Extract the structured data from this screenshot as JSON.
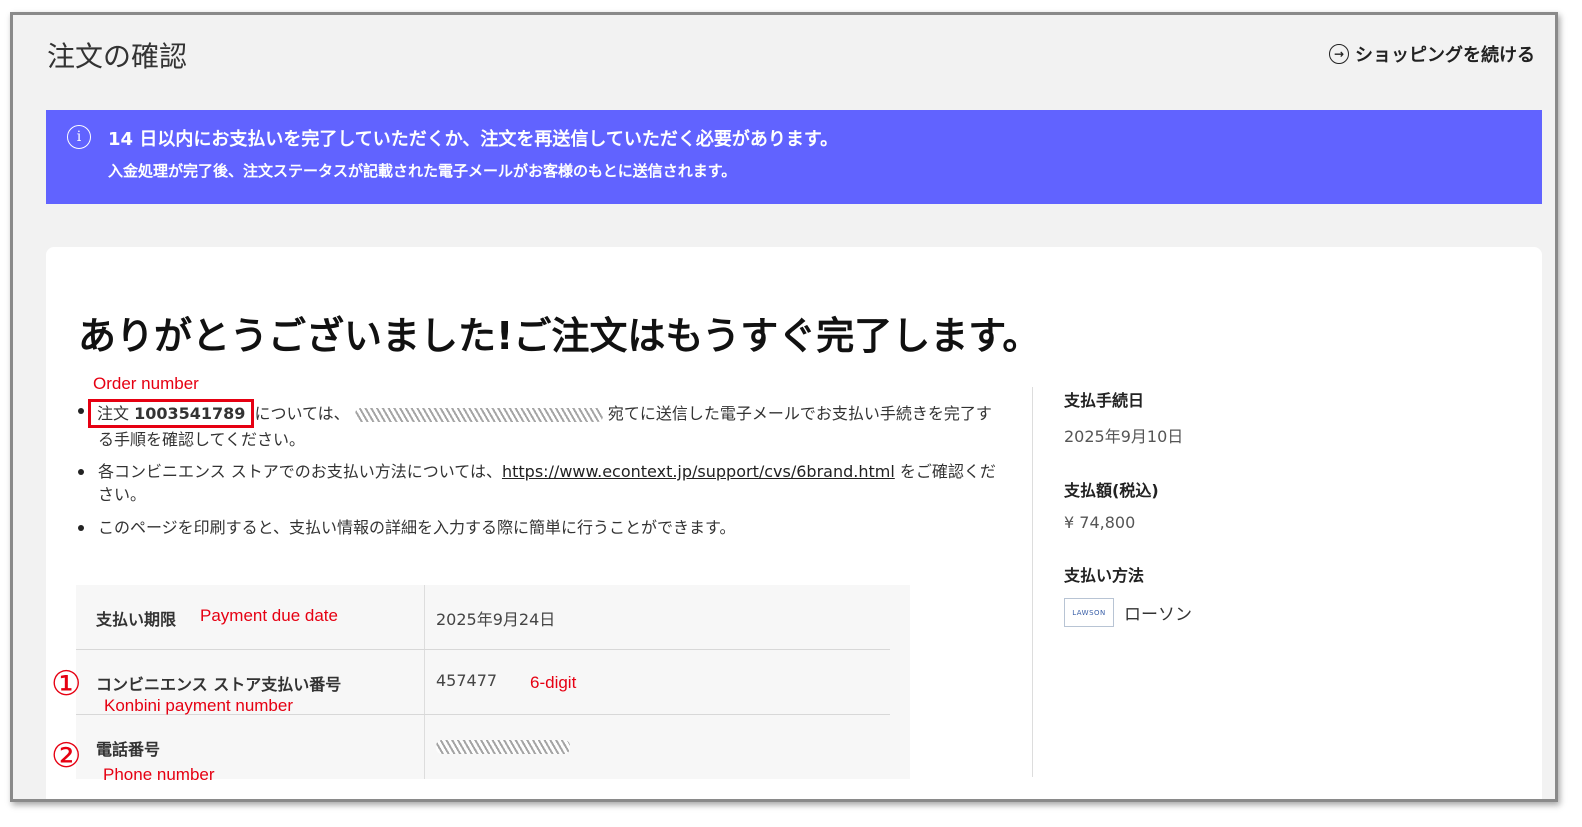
{
  "header": {
    "title": "注文の確認",
    "continue_label": "ショッピングを続ける"
  },
  "banner": {
    "line1": "14 日以内にお支払いを完了していただくか、注文を再送信していただく必要があります。",
    "line2": "入金処理が完了後、注文ステータスが記載された電子メールがお客様のもとに送信されます。"
  },
  "main": {
    "headline": "ありがとうございました!ご注文はもうすぐ完了します。",
    "bullets": {
      "b1_order_prefix": "注文",
      "b1_order_number": "1003541789",
      "b1_mid": "については、",
      "b1_end": "宛てに送信した電子メールでお支払い手続きを完了する手順を確認してください。",
      "b2_start": "各コンビニエンス ストアでのお支払い方法については、",
      "b2_link": "https://www.econtext.jp/support/cvs/6brand.html",
      "b2_end": "をご確認ください。",
      "b3": "このページを印刷すると、支払い情報の詳細を入力する際に簡単に行うことができます。"
    },
    "table": {
      "rows": [
        {
          "label": "支払い期限",
          "value": "2025年9月24日"
        },
        {
          "label": "コンビニエンス ストア支払い番号",
          "value": "457477"
        },
        {
          "label": "電話番号",
          "value": ""
        }
      ]
    }
  },
  "side": {
    "date_label": "支払手続日",
    "date_value": "2025年9月10日",
    "amount_label": "支払額(税込)",
    "amount_value": "¥ 74,800",
    "method_label": "支払い方法",
    "method_logo_text": "LAWSON",
    "method_name": "ローソン"
  },
  "annotations": {
    "order_number": "Order number",
    "payment_due": "Payment due date",
    "six_digit": "6-digit",
    "konbini": "Konbini payment number",
    "phone": "Phone number",
    "num1": "①",
    "num2": "②",
    "color": "#e60012"
  },
  "colors": {
    "banner": "#6163ff",
    "annotation": "#e60012"
  }
}
